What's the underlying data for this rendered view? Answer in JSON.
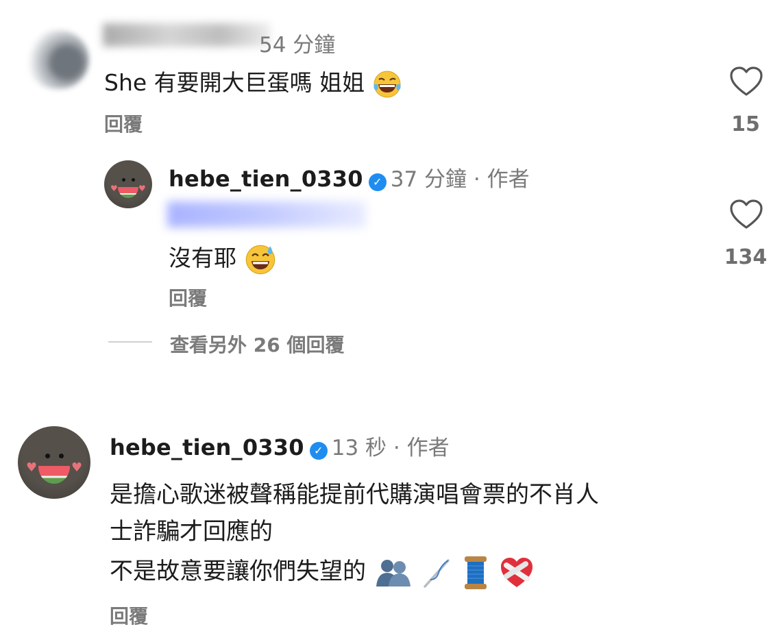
{
  "comment1": {
    "time": "54 分鐘",
    "text": "She 有要開大巨蛋嗎 姐姐",
    "emoji": "face-with-tears-of-joy",
    "reply_label": "回覆",
    "like_count": "15"
  },
  "reply1": {
    "username": "hebe_tien_0330",
    "time_author": "37 分鐘 · 作者",
    "text": "沒有耶",
    "emoji": "grinning-face-with-sweat",
    "reply_label": "回覆",
    "like_count": "134"
  },
  "view_more": "查看另外 26 個回覆",
  "comment2": {
    "username": "hebe_tien_0330",
    "time_author": "13 秒 · 作者",
    "line1": "是擔心歌迷被聲稱能提前代購演唱會票的不肖人",
    "line2": "士詐騙才回應的",
    "line3": "不是故意要讓你們失望的",
    "emojis": [
      "busts-in-silhouette",
      "sewing-needle",
      "spool-of-thread",
      "mending-heart"
    ],
    "reply_label": "回覆"
  },
  "colors": {
    "text": "#1c1c1c",
    "meta": "#7a7a7a",
    "verified": "#1f8df0"
  }
}
